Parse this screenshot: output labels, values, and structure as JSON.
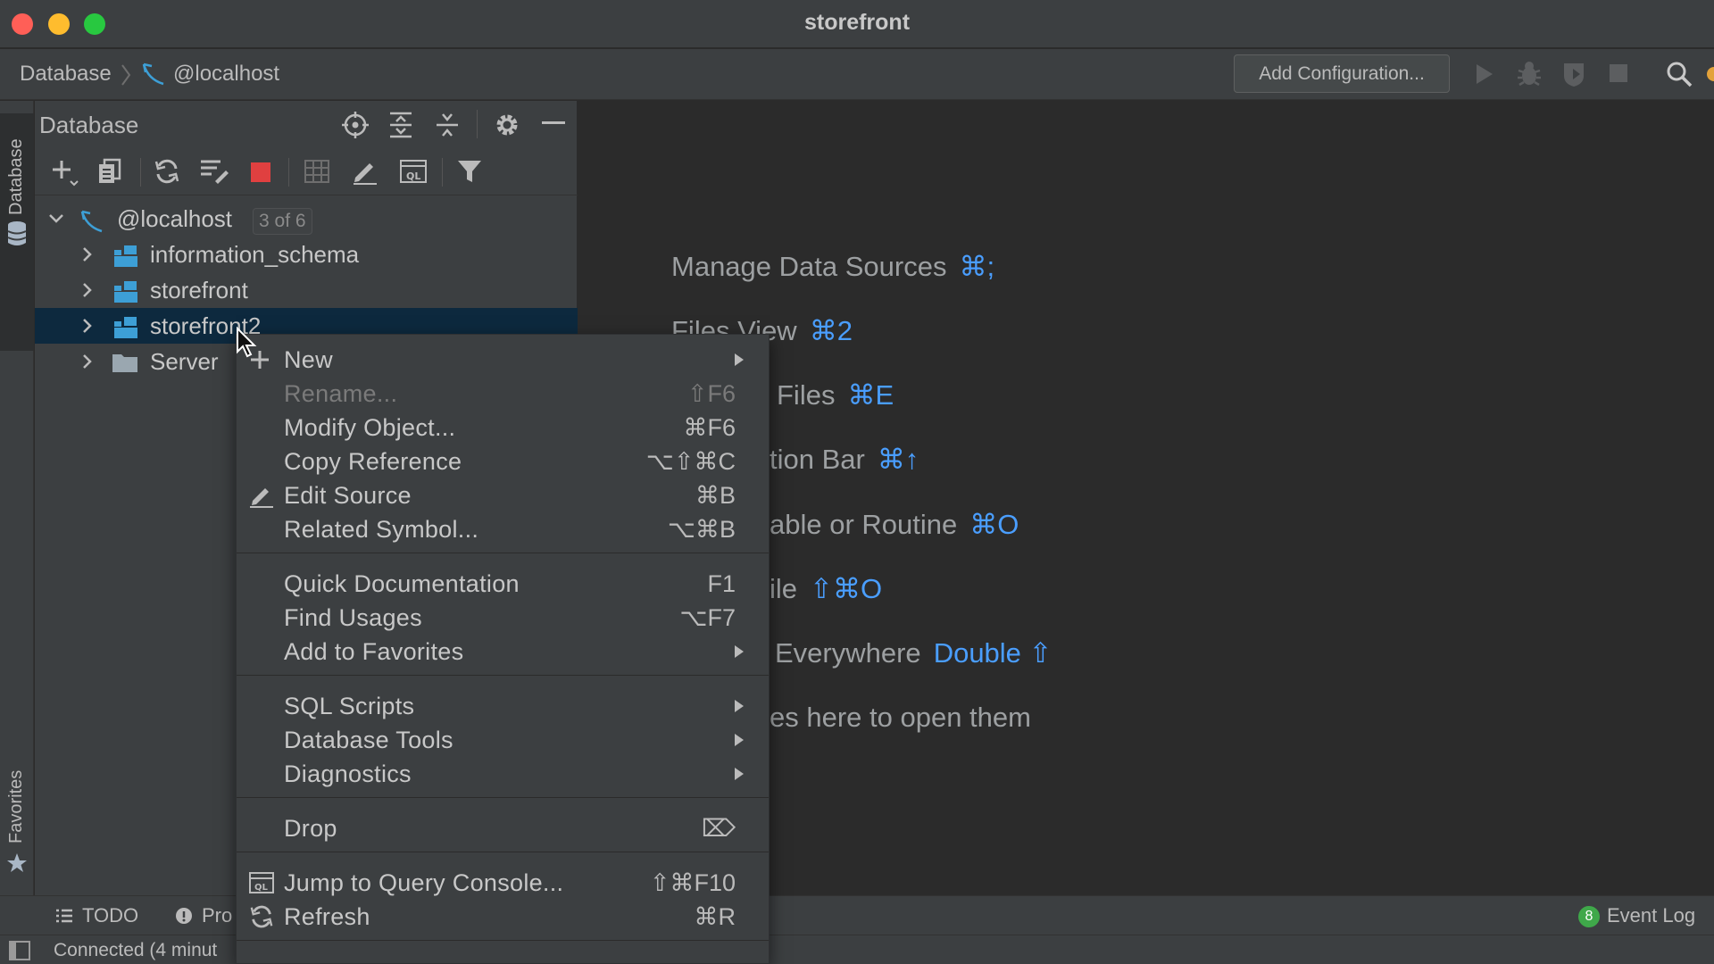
{
  "window": {
    "title": "storefront",
    "traffic_lights": {
      "close": "#ff5f57",
      "minimize": "#febc2e",
      "zoom": "#28c840"
    }
  },
  "navbar": {
    "breadcrumb_root": "Database",
    "breadcrumb_leaf": "@localhost",
    "add_configuration": "Add Configuration..."
  },
  "left_strip": {
    "database_tab": "Database",
    "favorites_tab": "Favorites"
  },
  "db_panel": {
    "title": "Database",
    "tree": [
      {
        "label": "@localhost",
        "badge": "3 of 6",
        "expanded": true,
        "level": 0
      },
      {
        "label": "information_schema",
        "expanded": false,
        "level": 1
      },
      {
        "label": "storefront",
        "expanded": false,
        "level": 1
      },
      {
        "label": "storefront2",
        "expanded": false,
        "level": 1,
        "selected": true
      },
      {
        "label": "Server",
        "expanded": false,
        "level": 1
      }
    ]
  },
  "editor_hints": [
    {
      "text": "Manage Data Sources",
      "key": "⌘;"
    },
    {
      "text": "Files View",
      "key": "⌘2"
    },
    {
      "text": "Files",
      "key": "⌘E"
    },
    {
      "text": "tion Bar",
      "key": "⌘↑"
    },
    {
      "text": "able or Routine",
      "key": "⌘O"
    },
    {
      "text": "ile",
      "key": "⇧⌘O"
    },
    {
      "text": "Everywhere",
      "key": "Double ⇧"
    },
    {
      "text": "es here to open them",
      "key": ""
    }
  ],
  "context_menu": {
    "items": [
      {
        "label": "New",
        "shortcut": "",
        "submenu": true,
        "icon": "plus-icon"
      },
      {
        "label": "Rename...",
        "shortcut": "⇧F6",
        "disabled": true
      },
      {
        "label": "Modify Object...",
        "shortcut": "⌘F6"
      },
      {
        "label": "Copy Reference",
        "shortcut": "⌥⇧⌘C"
      },
      {
        "label": "Edit Source",
        "shortcut": "⌘B",
        "icon": "pencil-icon"
      },
      {
        "label": "Related Symbol...",
        "shortcut": "⌥⌘B"
      },
      {
        "label": "Quick Documentation",
        "shortcut": "F1"
      },
      {
        "label": "Find Usages",
        "shortcut": "⌥F7"
      },
      {
        "label": "Add to Favorites",
        "shortcut": "",
        "submenu": true
      },
      {
        "label": "SQL Scripts",
        "shortcut": "",
        "submenu": true
      },
      {
        "label": "Database Tools",
        "shortcut": "",
        "submenu": true
      },
      {
        "label": "Diagnostics",
        "shortcut": "",
        "submenu": true
      },
      {
        "label": "Drop",
        "shortcut": "⌦"
      },
      {
        "label": "Jump to Query Console...",
        "shortcut": "⇧⌘F10",
        "icon": "query-console-icon"
      },
      {
        "label": "Refresh",
        "shortcut": "⌘R",
        "icon": "refresh-icon"
      }
    ]
  },
  "bottom_bar": {
    "todo": "TODO",
    "problems": "Pro",
    "event_log": "Event Log",
    "event_count": "8"
  },
  "status_bar": {
    "text": "Connected (4 minut"
  },
  "colors": {
    "background": "#2b2b2b",
    "panel": "#3c3f41",
    "selection": "#0d293e",
    "accent_blue": "#4a9eff",
    "db_icon": "#3d9fd6",
    "stop_red": "#e04040"
  }
}
